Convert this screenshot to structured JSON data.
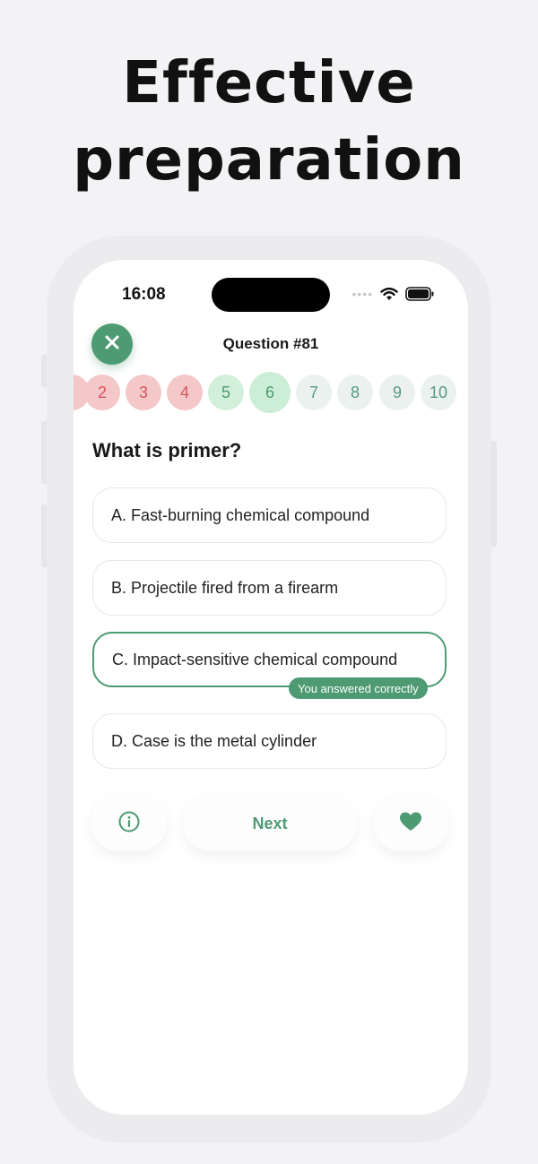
{
  "headline": {
    "line1": "Effective",
    "line2": "preparation"
  },
  "status": {
    "time": "16:08",
    "signal": "••••"
  },
  "header": {
    "title": "Question #81",
    "close_icon": "close-icon"
  },
  "question_numbers": [
    {
      "label": "2",
      "state": "wrong"
    },
    {
      "label": "3",
      "state": "wrong"
    },
    {
      "label": "4",
      "state": "wrong"
    },
    {
      "label": "5",
      "state": "right"
    },
    {
      "label": "6",
      "state": "current"
    },
    {
      "label": "7",
      "state": "pending"
    },
    {
      "label": "8",
      "state": "pending"
    },
    {
      "label": "9",
      "state": "pending"
    },
    {
      "label": "10",
      "state": "pending"
    }
  ],
  "question": {
    "text": "What is primer?"
  },
  "options": [
    {
      "label": "A. Fast-burning chemical compound"
    },
    {
      "label": "B. Projectile fired from a firearm"
    },
    {
      "label": "C. Impact-sensitive chemical compound"
    },
    {
      "label": "D. Case is the metal cylinder"
    }
  ],
  "feedback": {
    "correct_badge": "You answered correctly"
  },
  "actions": {
    "info_icon": "info-icon",
    "next_label": "Next",
    "favorite_icon": "heart-icon"
  },
  "colors": {
    "accent": "#4d9a73",
    "wrong_bg": "#f4c7c9",
    "wrong_text": "#d5565b",
    "right_bg": "#d2efd9"
  }
}
